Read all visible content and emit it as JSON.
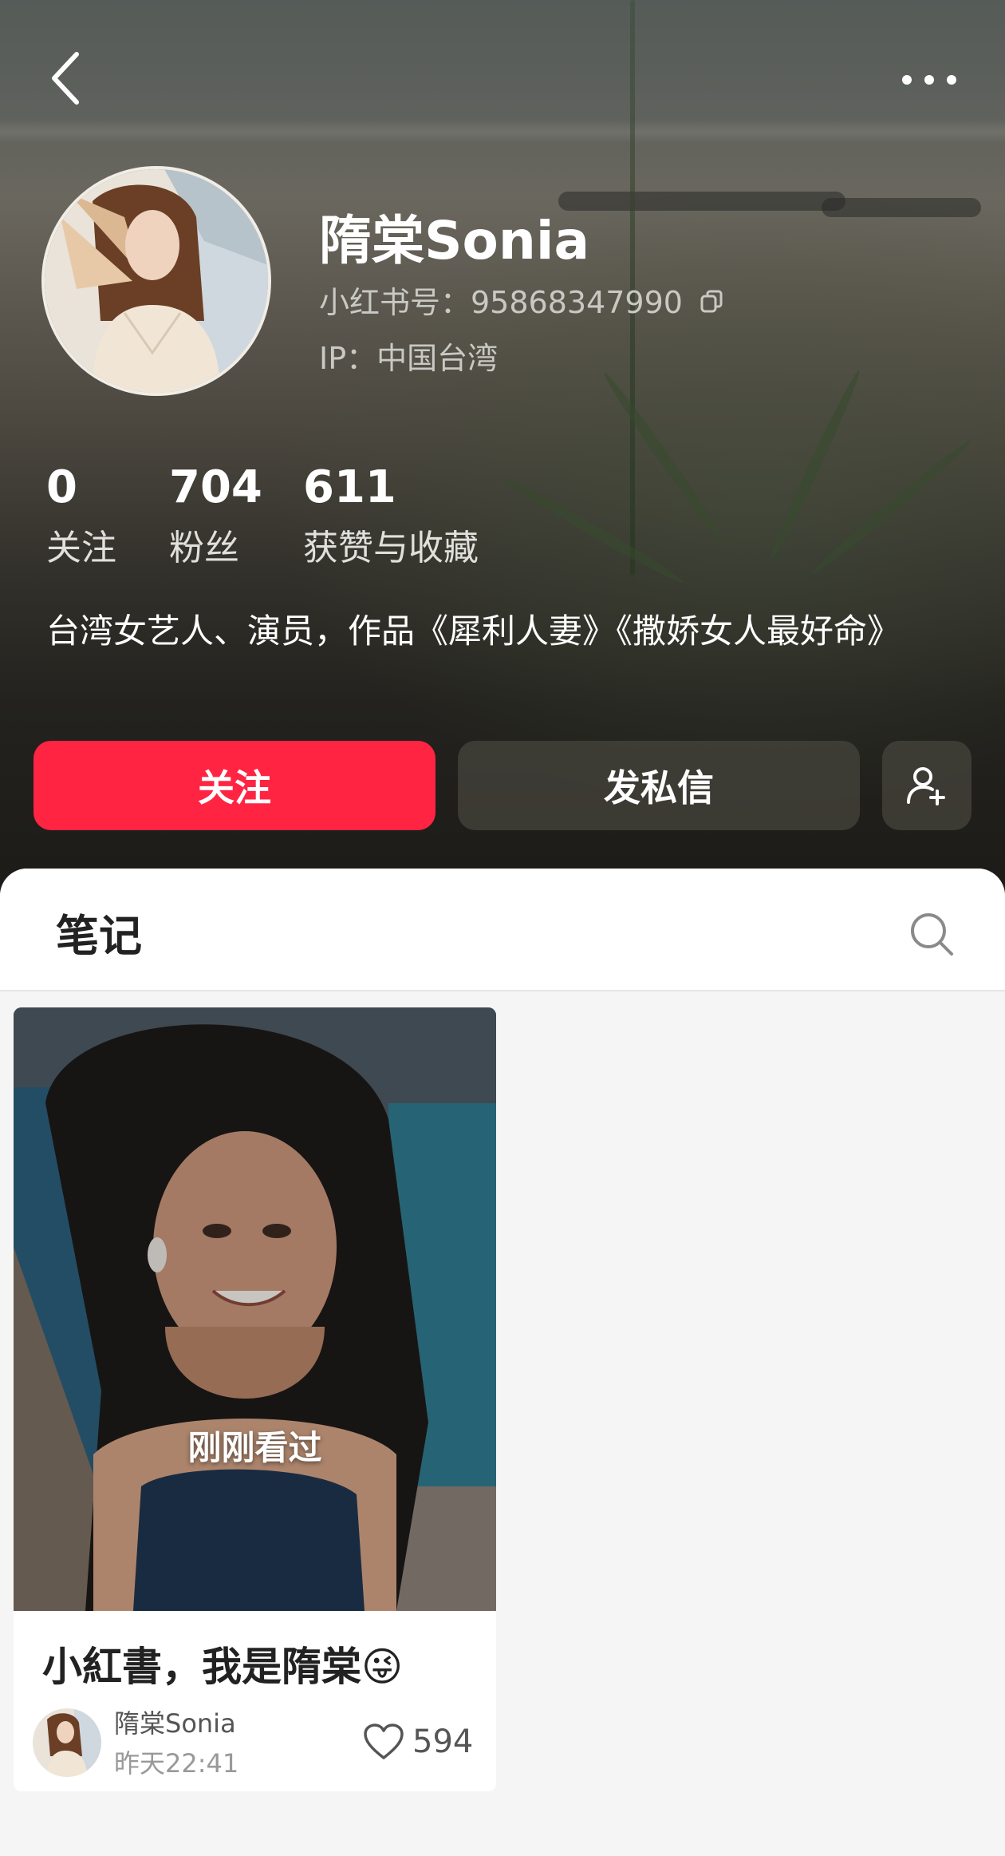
{
  "header": {
    "back_icon": "chevron-left-icon",
    "more_icon": "more-dots-icon"
  },
  "profile": {
    "nickname": "隋棠Sonia",
    "red_id": "小红书号：95868347990",
    "ip": "IP：中国台湾",
    "stats": [
      {
        "value": "0",
        "label": "关注"
      },
      {
        "value": "704",
        "label": "粉丝"
      },
      {
        "value": "611",
        "label": "获赞与收藏"
      }
    ],
    "bio": "台湾女艺人、演员，作品《犀利人妻》《撒娇女人最好命》"
  },
  "actions": {
    "follow_label": "关注",
    "message_label": "发私信",
    "follow_color": "#ff2442"
  },
  "notes": {
    "tab_label": "笔记",
    "items": [
      {
        "overlay_label": "刚刚看过",
        "title": "小紅書，我是隋棠😜",
        "author": "隋棠Sonia",
        "time": "昨天22:41",
        "likes": "594"
      }
    ]
  }
}
